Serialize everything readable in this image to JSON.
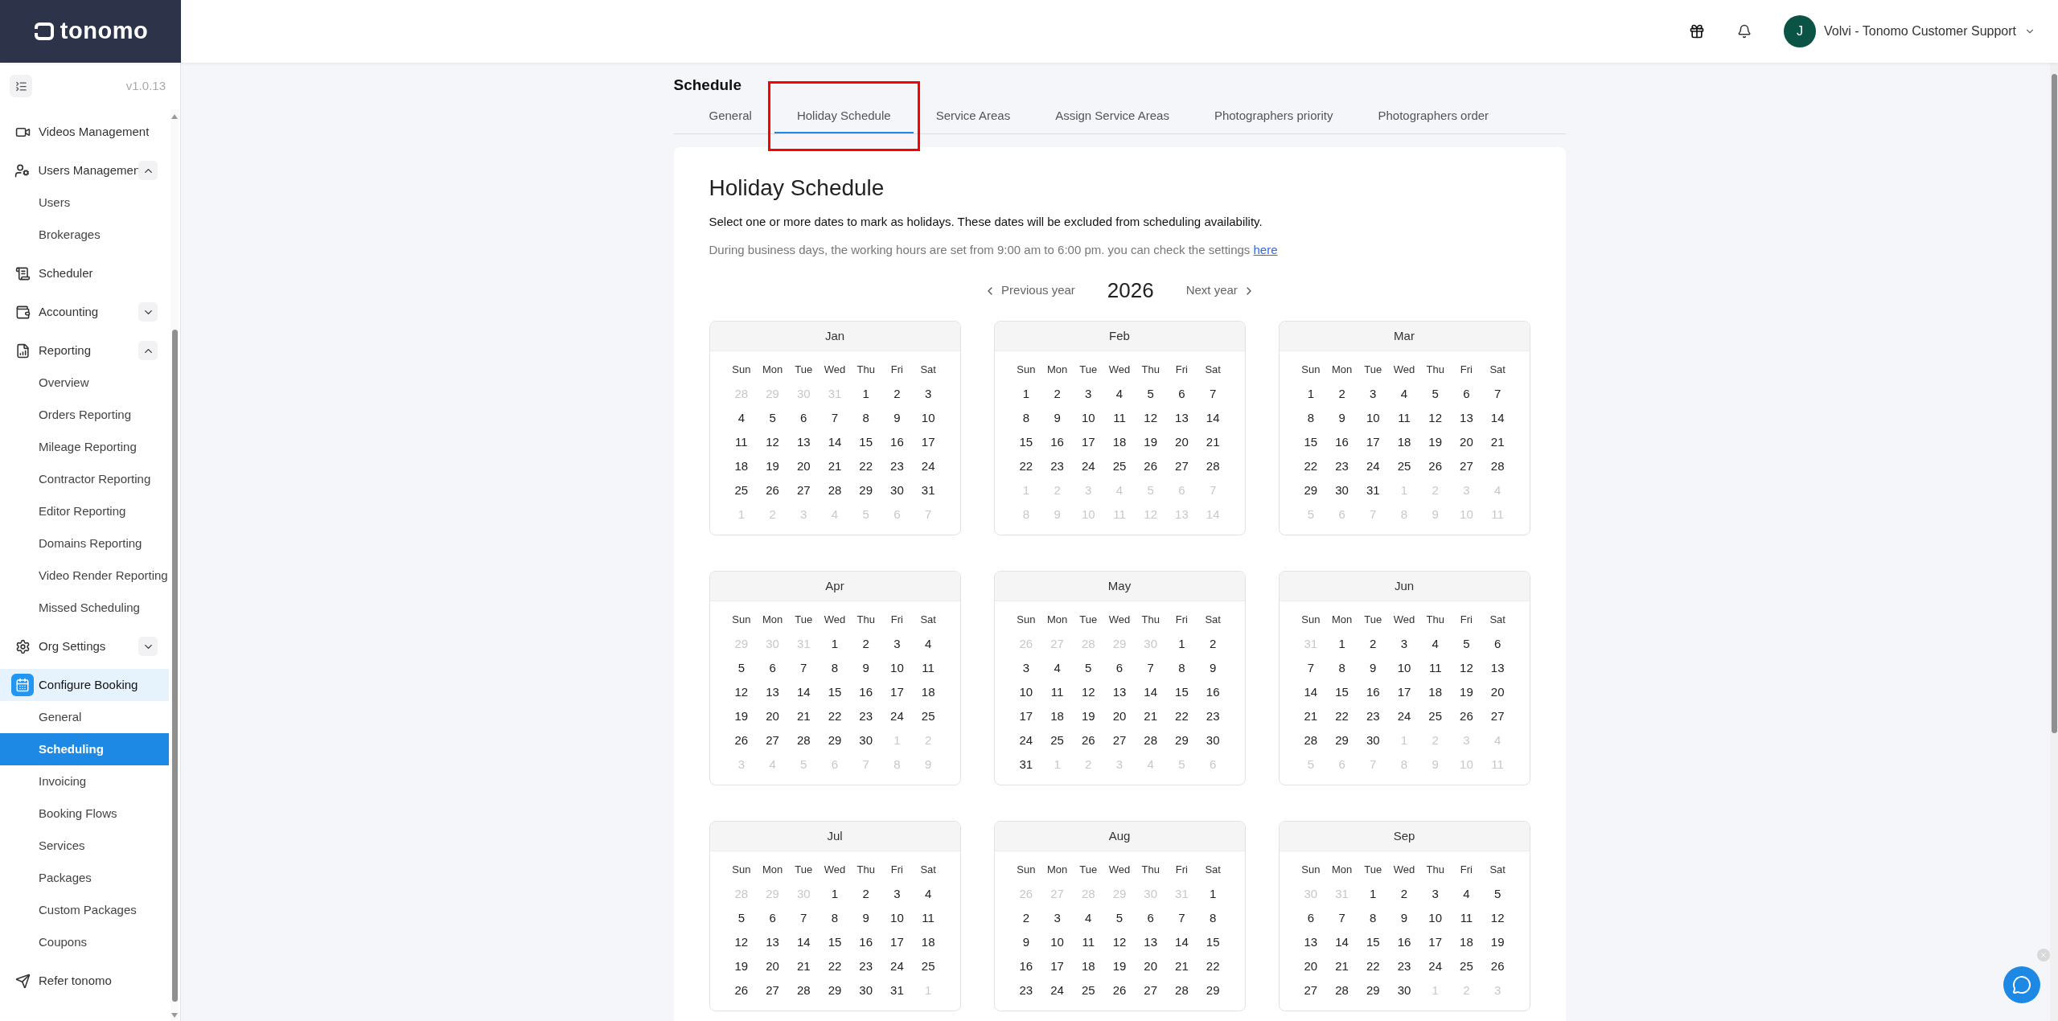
{
  "header": {
    "logo": "tonomo",
    "user": {
      "initial": "J",
      "name": "Volvi - Tonomo Customer Support"
    }
  },
  "sidebar": {
    "version": "v1.0.13",
    "items": [
      {
        "label": "Videos Management",
        "selected": false
      },
      {
        "label": "Users Managemen",
        "selected": false,
        "expanded": true,
        "children": [
          {
            "label": "Users",
            "selected": false
          },
          {
            "label": "Brokerages",
            "selected": false
          }
        ]
      },
      {
        "label": "Scheduler",
        "selected": false
      },
      {
        "label": "Accounting",
        "selected": false,
        "expanded": false
      },
      {
        "label": "Reporting",
        "selected": false,
        "expanded": true,
        "children": [
          {
            "label": "Overview",
            "selected": false
          },
          {
            "label": "Orders Reporting",
            "selected": false
          },
          {
            "label": "Mileage Reporting",
            "selected": false
          },
          {
            "label": "Contractor Reporting",
            "selected": false
          },
          {
            "label": "Editor Reporting",
            "selected": false
          },
          {
            "label": "Domains Reporting",
            "selected": false
          },
          {
            "label": "Video Render Reporting",
            "selected": false
          },
          {
            "label": "Missed Scheduling",
            "selected": false
          }
        ]
      },
      {
        "label": "Org Settings",
        "selected": false,
        "expanded": false
      },
      {
        "label": "Configure Booking",
        "selected": true,
        "children": [
          {
            "label": "General",
            "selected": false
          },
          {
            "label": "Scheduling",
            "selected": true
          },
          {
            "label": "Invoicing",
            "selected": false
          },
          {
            "label": "Booking Flows",
            "selected": false
          },
          {
            "label": "Services",
            "selected": false
          },
          {
            "label": "Packages",
            "selected": false
          },
          {
            "label": "Custom Packages",
            "selected": false
          },
          {
            "label": "Coupons",
            "selected": false
          }
        ]
      },
      {
        "label": "Refer tonomo",
        "selected": false
      }
    ]
  },
  "page": {
    "title": "Schedule",
    "tabs": [
      {
        "label": "General",
        "selected": false,
        "annotated": false
      },
      {
        "label": "Holiday Schedule",
        "selected": true,
        "annotated": true
      },
      {
        "label": "Service Areas",
        "selected": false,
        "annotated": false
      },
      {
        "label": "Assign Service Areas",
        "selected": false,
        "annotated": false
      },
      {
        "label": "Photographers priority",
        "selected": false,
        "annotated": false
      },
      {
        "label": "Photographers order",
        "selected": false,
        "annotated": false
      }
    ],
    "card": {
      "heading": "Holiday Schedule",
      "description": "Select one or more dates to mark as holidays. These dates will be excluded from scheduling availability.",
      "note": "During business days, the working hours are set from 9:00 am to 6:00 pm. you can check the settings",
      "note_link": "here",
      "year_nav": {
        "previous": "Previous year",
        "year": "2026",
        "next": "Next year"
      },
      "months": [
        {
          "name": "Jan",
          "weekdays": [
            "Sun",
            "Mon",
            "Tue",
            "Wed",
            "Thu",
            "Fri",
            "Sat"
          ],
          "days": [
            {
              "d": "28",
              "muted": true
            },
            {
              "d": "29",
              "muted": true
            },
            {
              "d": "30",
              "muted": true
            },
            {
              "d": "31",
              "muted": true
            },
            {
              "d": "1",
              "muted": false
            },
            {
              "d": "2",
              "muted": false
            },
            {
              "d": "3",
              "muted": false
            },
            {
              "d": "4",
              "muted": false
            },
            {
              "d": "5",
              "muted": false
            },
            {
              "d": "6",
              "muted": false
            },
            {
              "d": "7",
              "muted": false
            },
            {
              "d": "8",
              "muted": false
            },
            {
              "d": "9",
              "muted": false
            },
            {
              "d": "10",
              "muted": false
            },
            {
              "d": "11",
              "muted": false
            },
            {
              "d": "12",
              "muted": false
            },
            {
              "d": "13",
              "muted": false
            },
            {
              "d": "14",
              "muted": false
            },
            {
              "d": "15",
              "muted": false
            },
            {
              "d": "16",
              "muted": false
            },
            {
              "d": "17",
              "muted": false
            },
            {
              "d": "18",
              "muted": false
            },
            {
              "d": "19",
              "muted": false
            },
            {
              "d": "20",
              "muted": false
            },
            {
              "d": "21",
              "muted": false
            },
            {
              "d": "22",
              "muted": false
            },
            {
              "d": "23",
              "muted": false
            },
            {
              "d": "24",
              "muted": false
            },
            {
              "d": "25",
              "muted": false
            },
            {
              "d": "26",
              "muted": false
            },
            {
              "d": "27",
              "muted": false
            },
            {
              "d": "28",
              "muted": false
            },
            {
              "d": "29",
              "muted": false
            },
            {
              "d": "30",
              "muted": false
            },
            {
              "d": "31",
              "muted": false
            },
            {
              "d": "1",
              "muted": true
            },
            {
              "d": "2",
              "muted": true
            },
            {
              "d": "3",
              "muted": true
            },
            {
              "d": "4",
              "muted": true
            },
            {
              "d": "5",
              "muted": true
            },
            {
              "d": "6",
              "muted": true
            },
            {
              "d": "7",
              "muted": true
            }
          ]
        },
        {
          "name": "Feb",
          "weekdays": [
            "Sun",
            "Mon",
            "Tue",
            "Wed",
            "Thu",
            "Fri",
            "Sat"
          ],
          "days": [
            {
              "d": "1",
              "muted": false
            },
            {
              "d": "2",
              "muted": false
            },
            {
              "d": "3",
              "muted": false
            },
            {
              "d": "4",
              "muted": false
            },
            {
              "d": "5",
              "muted": false
            },
            {
              "d": "6",
              "muted": false
            },
            {
              "d": "7",
              "muted": false
            },
            {
              "d": "8",
              "muted": false
            },
            {
              "d": "9",
              "muted": false
            },
            {
              "d": "10",
              "muted": false
            },
            {
              "d": "11",
              "muted": false
            },
            {
              "d": "12",
              "muted": false
            },
            {
              "d": "13",
              "muted": false
            },
            {
              "d": "14",
              "muted": false
            },
            {
              "d": "15",
              "muted": false
            },
            {
              "d": "16",
              "muted": false
            },
            {
              "d": "17",
              "muted": false
            },
            {
              "d": "18",
              "muted": false
            },
            {
              "d": "19",
              "muted": false
            },
            {
              "d": "20",
              "muted": false
            },
            {
              "d": "21",
              "muted": false
            },
            {
              "d": "22",
              "muted": false
            },
            {
              "d": "23",
              "muted": false
            },
            {
              "d": "24",
              "muted": false
            },
            {
              "d": "25",
              "muted": false
            },
            {
              "d": "26",
              "muted": false
            },
            {
              "d": "27",
              "muted": false
            },
            {
              "d": "28",
              "muted": false
            },
            {
              "d": "1",
              "muted": true
            },
            {
              "d": "2",
              "muted": true
            },
            {
              "d": "3",
              "muted": true
            },
            {
              "d": "4",
              "muted": true
            },
            {
              "d": "5",
              "muted": true
            },
            {
              "d": "6",
              "muted": true
            },
            {
              "d": "7",
              "muted": true
            },
            {
              "d": "8",
              "muted": true
            },
            {
              "d": "9",
              "muted": true
            },
            {
              "d": "10",
              "muted": true
            },
            {
              "d": "11",
              "muted": true
            },
            {
              "d": "12",
              "muted": true
            },
            {
              "d": "13",
              "muted": true
            },
            {
              "d": "14",
              "muted": true
            }
          ]
        },
        {
          "name": "Mar",
          "weekdays": [
            "Sun",
            "Mon",
            "Tue",
            "Wed",
            "Thu",
            "Fri",
            "Sat"
          ],
          "days": [
            {
              "d": "1",
              "muted": false
            },
            {
              "d": "2",
              "muted": false
            },
            {
              "d": "3",
              "muted": false
            },
            {
              "d": "4",
              "muted": false
            },
            {
              "d": "5",
              "muted": false
            },
            {
              "d": "6",
              "muted": false
            },
            {
              "d": "7",
              "muted": false
            },
            {
              "d": "8",
              "muted": false
            },
            {
              "d": "9",
              "muted": false
            },
            {
              "d": "10",
              "muted": false
            },
            {
              "d": "11",
              "muted": false
            },
            {
              "d": "12",
              "muted": false
            },
            {
              "d": "13",
              "muted": false
            },
            {
              "d": "14",
              "muted": false
            },
            {
              "d": "15",
              "muted": false
            },
            {
              "d": "16",
              "muted": false
            },
            {
              "d": "17",
              "muted": false
            },
            {
              "d": "18",
              "muted": false
            },
            {
              "d": "19",
              "muted": false
            },
            {
              "d": "20",
              "muted": false
            },
            {
              "d": "21",
              "muted": false
            },
            {
              "d": "22",
              "muted": false
            },
            {
              "d": "23",
              "muted": false
            },
            {
              "d": "24",
              "muted": false
            },
            {
              "d": "25",
              "muted": false
            },
            {
              "d": "26",
              "muted": false
            },
            {
              "d": "27",
              "muted": false
            },
            {
              "d": "28",
              "muted": false
            },
            {
              "d": "29",
              "muted": false
            },
            {
              "d": "30",
              "muted": false
            },
            {
              "d": "31",
              "muted": false
            },
            {
              "d": "1",
              "muted": true
            },
            {
              "d": "2",
              "muted": true
            },
            {
              "d": "3",
              "muted": true
            },
            {
              "d": "4",
              "muted": true
            },
            {
              "d": "5",
              "muted": true
            },
            {
              "d": "6",
              "muted": true
            },
            {
              "d": "7",
              "muted": true
            },
            {
              "d": "8",
              "muted": true
            },
            {
              "d": "9",
              "muted": true
            },
            {
              "d": "10",
              "muted": true
            },
            {
              "d": "11",
              "muted": true
            }
          ]
        },
        {
          "name": "Apr",
          "weekdays": [
            "Sun",
            "Mon",
            "Tue",
            "Wed",
            "Thu",
            "Fri",
            "Sat"
          ],
          "days": [
            {
              "d": "29",
              "muted": true
            },
            {
              "d": "30",
              "muted": true
            },
            {
              "d": "31",
              "muted": true
            },
            {
              "d": "1",
              "muted": false
            },
            {
              "d": "2",
              "muted": false
            },
            {
              "d": "3",
              "muted": false
            },
            {
              "d": "4",
              "muted": false
            },
            {
              "d": "5",
              "muted": false
            },
            {
              "d": "6",
              "muted": false
            },
            {
              "d": "7",
              "muted": false
            },
            {
              "d": "8",
              "muted": false
            },
            {
              "d": "9",
              "muted": false
            },
            {
              "d": "10",
              "muted": false
            },
            {
              "d": "11",
              "muted": false
            },
            {
              "d": "12",
              "muted": false
            },
            {
              "d": "13",
              "muted": false
            },
            {
              "d": "14",
              "muted": false
            },
            {
              "d": "15",
              "muted": false
            },
            {
              "d": "16",
              "muted": false
            },
            {
              "d": "17",
              "muted": false
            },
            {
              "d": "18",
              "muted": false
            },
            {
              "d": "19",
              "muted": false
            },
            {
              "d": "20",
              "muted": false
            },
            {
              "d": "21",
              "muted": false
            },
            {
              "d": "22",
              "muted": false
            },
            {
              "d": "23",
              "muted": false
            },
            {
              "d": "24",
              "muted": false
            },
            {
              "d": "25",
              "muted": false
            },
            {
              "d": "26",
              "muted": false
            },
            {
              "d": "27",
              "muted": false
            },
            {
              "d": "28",
              "muted": false
            },
            {
              "d": "29",
              "muted": false
            },
            {
              "d": "30",
              "muted": false
            },
            {
              "d": "1",
              "muted": true
            },
            {
              "d": "2",
              "muted": true
            },
            {
              "d": "3",
              "muted": true
            },
            {
              "d": "4",
              "muted": true
            },
            {
              "d": "5",
              "muted": true
            },
            {
              "d": "6",
              "muted": true
            },
            {
              "d": "7",
              "muted": true
            },
            {
              "d": "8",
              "muted": true
            },
            {
              "d": "9",
              "muted": true
            }
          ]
        },
        {
          "name": "May",
          "weekdays": [
            "Sun",
            "Mon",
            "Tue",
            "Wed",
            "Thu",
            "Fri",
            "Sat"
          ],
          "days": [
            {
              "d": "26",
              "muted": true
            },
            {
              "d": "27",
              "muted": true
            },
            {
              "d": "28",
              "muted": true
            },
            {
              "d": "29",
              "muted": true
            },
            {
              "d": "30",
              "muted": true
            },
            {
              "d": "1",
              "muted": false
            },
            {
              "d": "2",
              "muted": false
            },
            {
              "d": "3",
              "muted": false
            },
            {
              "d": "4",
              "muted": false
            },
            {
              "d": "5",
              "muted": false
            },
            {
              "d": "6",
              "muted": false
            },
            {
              "d": "7",
              "muted": false
            },
            {
              "d": "8",
              "muted": false
            },
            {
              "d": "9",
              "muted": false
            },
            {
              "d": "10",
              "muted": false
            },
            {
              "d": "11",
              "muted": false
            },
            {
              "d": "12",
              "muted": false
            },
            {
              "d": "13",
              "muted": false
            },
            {
              "d": "14",
              "muted": false
            },
            {
              "d": "15",
              "muted": false
            },
            {
              "d": "16",
              "muted": false
            },
            {
              "d": "17",
              "muted": false
            },
            {
              "d": "18",
              "muted": false
            },
            {
              "d": "19",
              "muted": false
            },
            {
              "d": "20",
              "muted": false
            },
            {
              "d": "21",
              "muted": false
            },
            {
              "d": "22",
              "muted": false
            },
            {
              "d": "23",
              "muted": false
            },
            {
              "d": "24",
              "muted": false
            },
            {
              "d": "25",
              "muted": false
            },
            {
              "d": "26",
              "muted": false
            },
            {
              "d": "27",
              "muted": false
            },
            {
              "d": "28",
              "muted": false
            },
            {
              "d": "29",
              "muted": false
            },
            {
              "d": "30",
              "muted": false
            },
            {
              "d": "31",
              "muted": false
            },
            {
              "d": "1",
              "muted": true
            },
            {
              "d": "2",
              "muted": true
            },
            {
              "d": "3",
              "muted": true
            },
            {
              "d": "4",
              "muted": true
            },
            {
              "d": "5",
              "muted": true
            },
            {
              "d": "6",
              "muted": true
            }
          ]
        },
        {
          "name": "Jun",
          "weekdays": [
            "Sun",
            "Mon",
            "Tue",
            "Wed",
            "Thu",
            "Fri",
            "Sat"
          ],
          "days": [
            {
              "d": "31",
              "muted": true
            },
            {
              "d": "1",
              "muted": false
            },
            {
              "d": "2",
              "muted": false
            },
            {
              "d": "3",
              "muted": false
            },
            {
              "d": "4",
              "muted": false
            },
            {
              "d": "5",
              "muted": false
            },
            {
              "d": "6",
              "muted": false
            },
            {
              "d": "7",
              "muted": false
            },
            {
              "d": "8",
              "muted": false
            },
            {
              "d": "9",
              "muted": false
            },
            {
              "d": "10",
              "muted": false
            },
            {
              "d": "11",
              "muted": false
            },
            {
              "d": "12",
              "muted": false
            },
            {
              "d": "13",
              "muted": false
            },
            {
              "d": "14",
              "muted": false
            },
            {
              "d": "15",
              "muted": false
            },
            {
              "d": "16",
              "muted": false
            },
            {
              "d": "17",
              "muted": false
            },
            {
              "d": "18",
              "muted": false
            },
            {
              "d": "19",
              "muted": false
            },
            {
              "d": "20",
              "muted": false
            },
            {
              "d": "21",
              "muted": false
            },
            {
              "d": "22",
              "muted": false
            },
            {
              "d": "23",
              "muted": false
            },
            {
              "d": "24",
              "muted": false
            },
            {
              "d": "25",
              "muted": false
            },
            {
              "d": "26",
              "muted": false
            },
            {
              "d": "27",
              "muted": false
            },
            {
              "d": "28",
              "muted": false
            },
            {
              "d": "29",
              "muted": false
            },
            {
              "d": "30",
              "muted": false
            },
            {
              "d": "1",
              "muted": true
            },
            {
              "d": "2",
              "muted": true
            },
            {
              "d": "3",
              "muted": true
            },
            {
              "d": "4",
              "muted": true
            },
            {
              "d": "5",
              "muted": true
            },
            {
              "d": "6",
              "muted": true
            },
            {
              "d": "7",
              "muted": true
            },
            {
              "d": "8",
              "muted": true
            },
            {
              "d": "9",
              "muted": true
            },
            {
              "d": "10",
              "muted": true
            },
            {
              "d": "11",
              "muted": true
            }
          ]
        },
        {
          "name": "Jul",
          "weekdays": [
            "Sun",
            "Mon",
            "Tue",
            "Wed",
            "Thu",
            "Fri",
            "Sat"
          ],
          "days": [
            {
              "d": "28",
              "muted": true
            },
            {
              "d": "29",
              "muted": true
            },
            {
              "d": "30",
              "muted": true
            },
            {
              "d": "1",
              "muted": false
            },
            {
              "d": "2",
              "muted": false
            },
            {
              "d": "3",
              "muted": false
            },
            {
              "d": "4",
              "muted": false
            },
            {
              "d": "5",
              "muted": false
            },
            {
              "d": "6",
              "muted": false
            },
            {
              "d": "7",
              "muted": false
            },
            {
              "d": "8",
              "muted": false
            },
            {
              "d": "9",
              "muted": false
            },
            {
              "d": "10",
              "muted": false
            },
            {
              "d": "11",
              "muted": false
            },
            {
              "d": "12",
              "muted": false
            },
            {
              "d": "13",
              "muted": false
            },
            {
              "d": "14",
              "muted": false
            },
            {
              "d": "15",
              "muted": false
            },
            {
              "d": "16",
              "muted": false
            },
            {
              "d": "17",
              "muted": false
            },
            {
              "d": "18",
              "muted": false
            },
            {
              "d": "19",
              "muted": false
            },
            {
              "d": "20",
              "muted": false
            },
            {
              "d": "21",
              "muted": false
            },
            {
              "d": "22",
              "muted": false
            },
            {
              "d": "23",
              "muted": false
            },
            {
              "d": "24",
              "muted": false
            },
            {
              "d": "25",
              "muted": false
            },
            {
              "d": "26",
              "muted": false
            },
            {
              "d": "27",
              "muted": false
            },
            {
              "d": "28",
              "muted": false
            },
            {
              "d": "29",
              "muted": false
            },
            {
              "d": "30",
              "muted": false
            },
            {
              "d": "31",
              "muted": false
            },
            {
              "d": "1",
              "muted": true
            }
          ]
        },
        {
          "name": "Aug",
          "weekdays": [
            "Sun",
            "Mon",
            "Tue",
            "Wed",
            "Thu",
            "Fri",
            "Sat"
          ],
          "days": [
            {
              "d": "26",
              "muted": true
            },
            {
              "d": "27",
              "muted": true
            },
            {
              "d": "28",
              "muted": true
            },
            {
              "d": "29",
              "muted": true
            },
            {
              "d": "30",
              "muted": true
            },
            {
              "d": "31",
              "muted": true
            },
            {
              "d": "1",
              "muted": false
            },
            {
              "d": "2",
              "muted": false
            },
            {
              "d": "3",
              "muted": false
            },
            {
              "d": "4",
              "muted": false
            },
            {
              "d": "5",
              "muted": false
            },
            {
              "d": "6",
              "muted": false
            },
            {
              "d": "7",
              "muted": false
            },
            {
              "d": "8",
              "muted": false
            },
            {
              "d": "9",
              "muted": false
            },
            {
              "d": "10",
              "muted": false
            },
            {
              "d": "11",
              "muted": false
            },
            {
              "d": "12",
              "muted": false
            },
            {
              "d": "13",
              "muted": false
            },
            {
              "d": "14",
              "muted": false
            },
            {
              "d": "15",
              "muted": false
            },
            {
              "d": "16",
              "muted": false
            },
            {
              "d": "17",
              "muted": false
            },
            {
              "d": "18",
              "muted": false
            },
            {
              "d": "19",
              "muted": false
            },
            {
              "d": "20",
              "muted": false
            },
            {
              "d": "21",
              "muted": false
            },
            {
              "d": "22",
              "muted": false
            },
            {
              "d": "23",
              "muted": false
            },
            {
              "d": "24",
              "muted": false
            },
            {
              "d": "25",
              "muted": false
            },
            {
              "d": "26",
              "muted": false
            },
            {
              "d": "27",
              "muted": false
            },
            {
              "d": "28",
              "muted": false
            },
            {
              "d": "29",
              "muted": false
            }
          ]
        },
        {
          "name": "Sep",
          "weekdays": [
            "Sun",
            "Mon",
            "Tue",
            "Wed",
            "Thu",
            "Fri",
            "Sat"
          ],
          "days": [
            {
              "d": "30",
              "muted": true
            },
            {
              "d": "31",
              "muted": true
            },
            {
              "d": "1",
              "muted": false
            },
            {
              "d": "2",
              "muted": false
            },
            {
              "d": "3",
              "muted": false
            },
            {
              "d": "4",
              "muted": false
            },
            {
              "d": "5",
              "muted": false
            },
            {
              "d": "6",
              "muted": false
            },
            {
              "d": "7",
              "muted": false
            },
            {
              "d": "8",
              "muted": false
            },
            {
              "d": "9",
              "muted": false
            },
            {
              "d": "10",
              "muted": false
            },
            {
              "d": "11",
              "muted": false
            },
            {
              "d": "12",
              "muted": false
            },
            {
              "d": "13",
              "muted": false
            },
            {
              "d": "14",
              "muted": false
            },
            {
              "d": "15",
              "muted": false
            },
            {
              "d": "16",
              "muted": false
            },
            {
              "d": "17",
              "muted": false
            },
            {
              "d": "18",
              "muted": false
            },
            {
              "d": "19",
              "muted": false
            },
            {
              "d": "20",
              "muted": false
            },
            {
              "d": "21",
              "muted": false
            },
            {
              "d": "22",
              "muted": false
            },
            {
              "d": "23",
              "muted": false
            },
            {
              "d": "24",
              "muted": false
            },
            {
              "d": "25",
              "muted": false
            },
            {
              "d": "26",
              "muted": false
            },
            {
              "d": "27",
              "muted": false
            },
            {
              "d": "28",
              "muted": false
            },
            {
              "d": "29",
              "muted": false
            },
            {
              "d": "30",
              "muted": false
            },
            {
              "d": "1",
              "muted": true
            },
            {
              "d": "2",
              "muted": true
            },
            {
              "d": "3",
              "muted": true
            }
          ]
        }
      ]
    }
  }
}
